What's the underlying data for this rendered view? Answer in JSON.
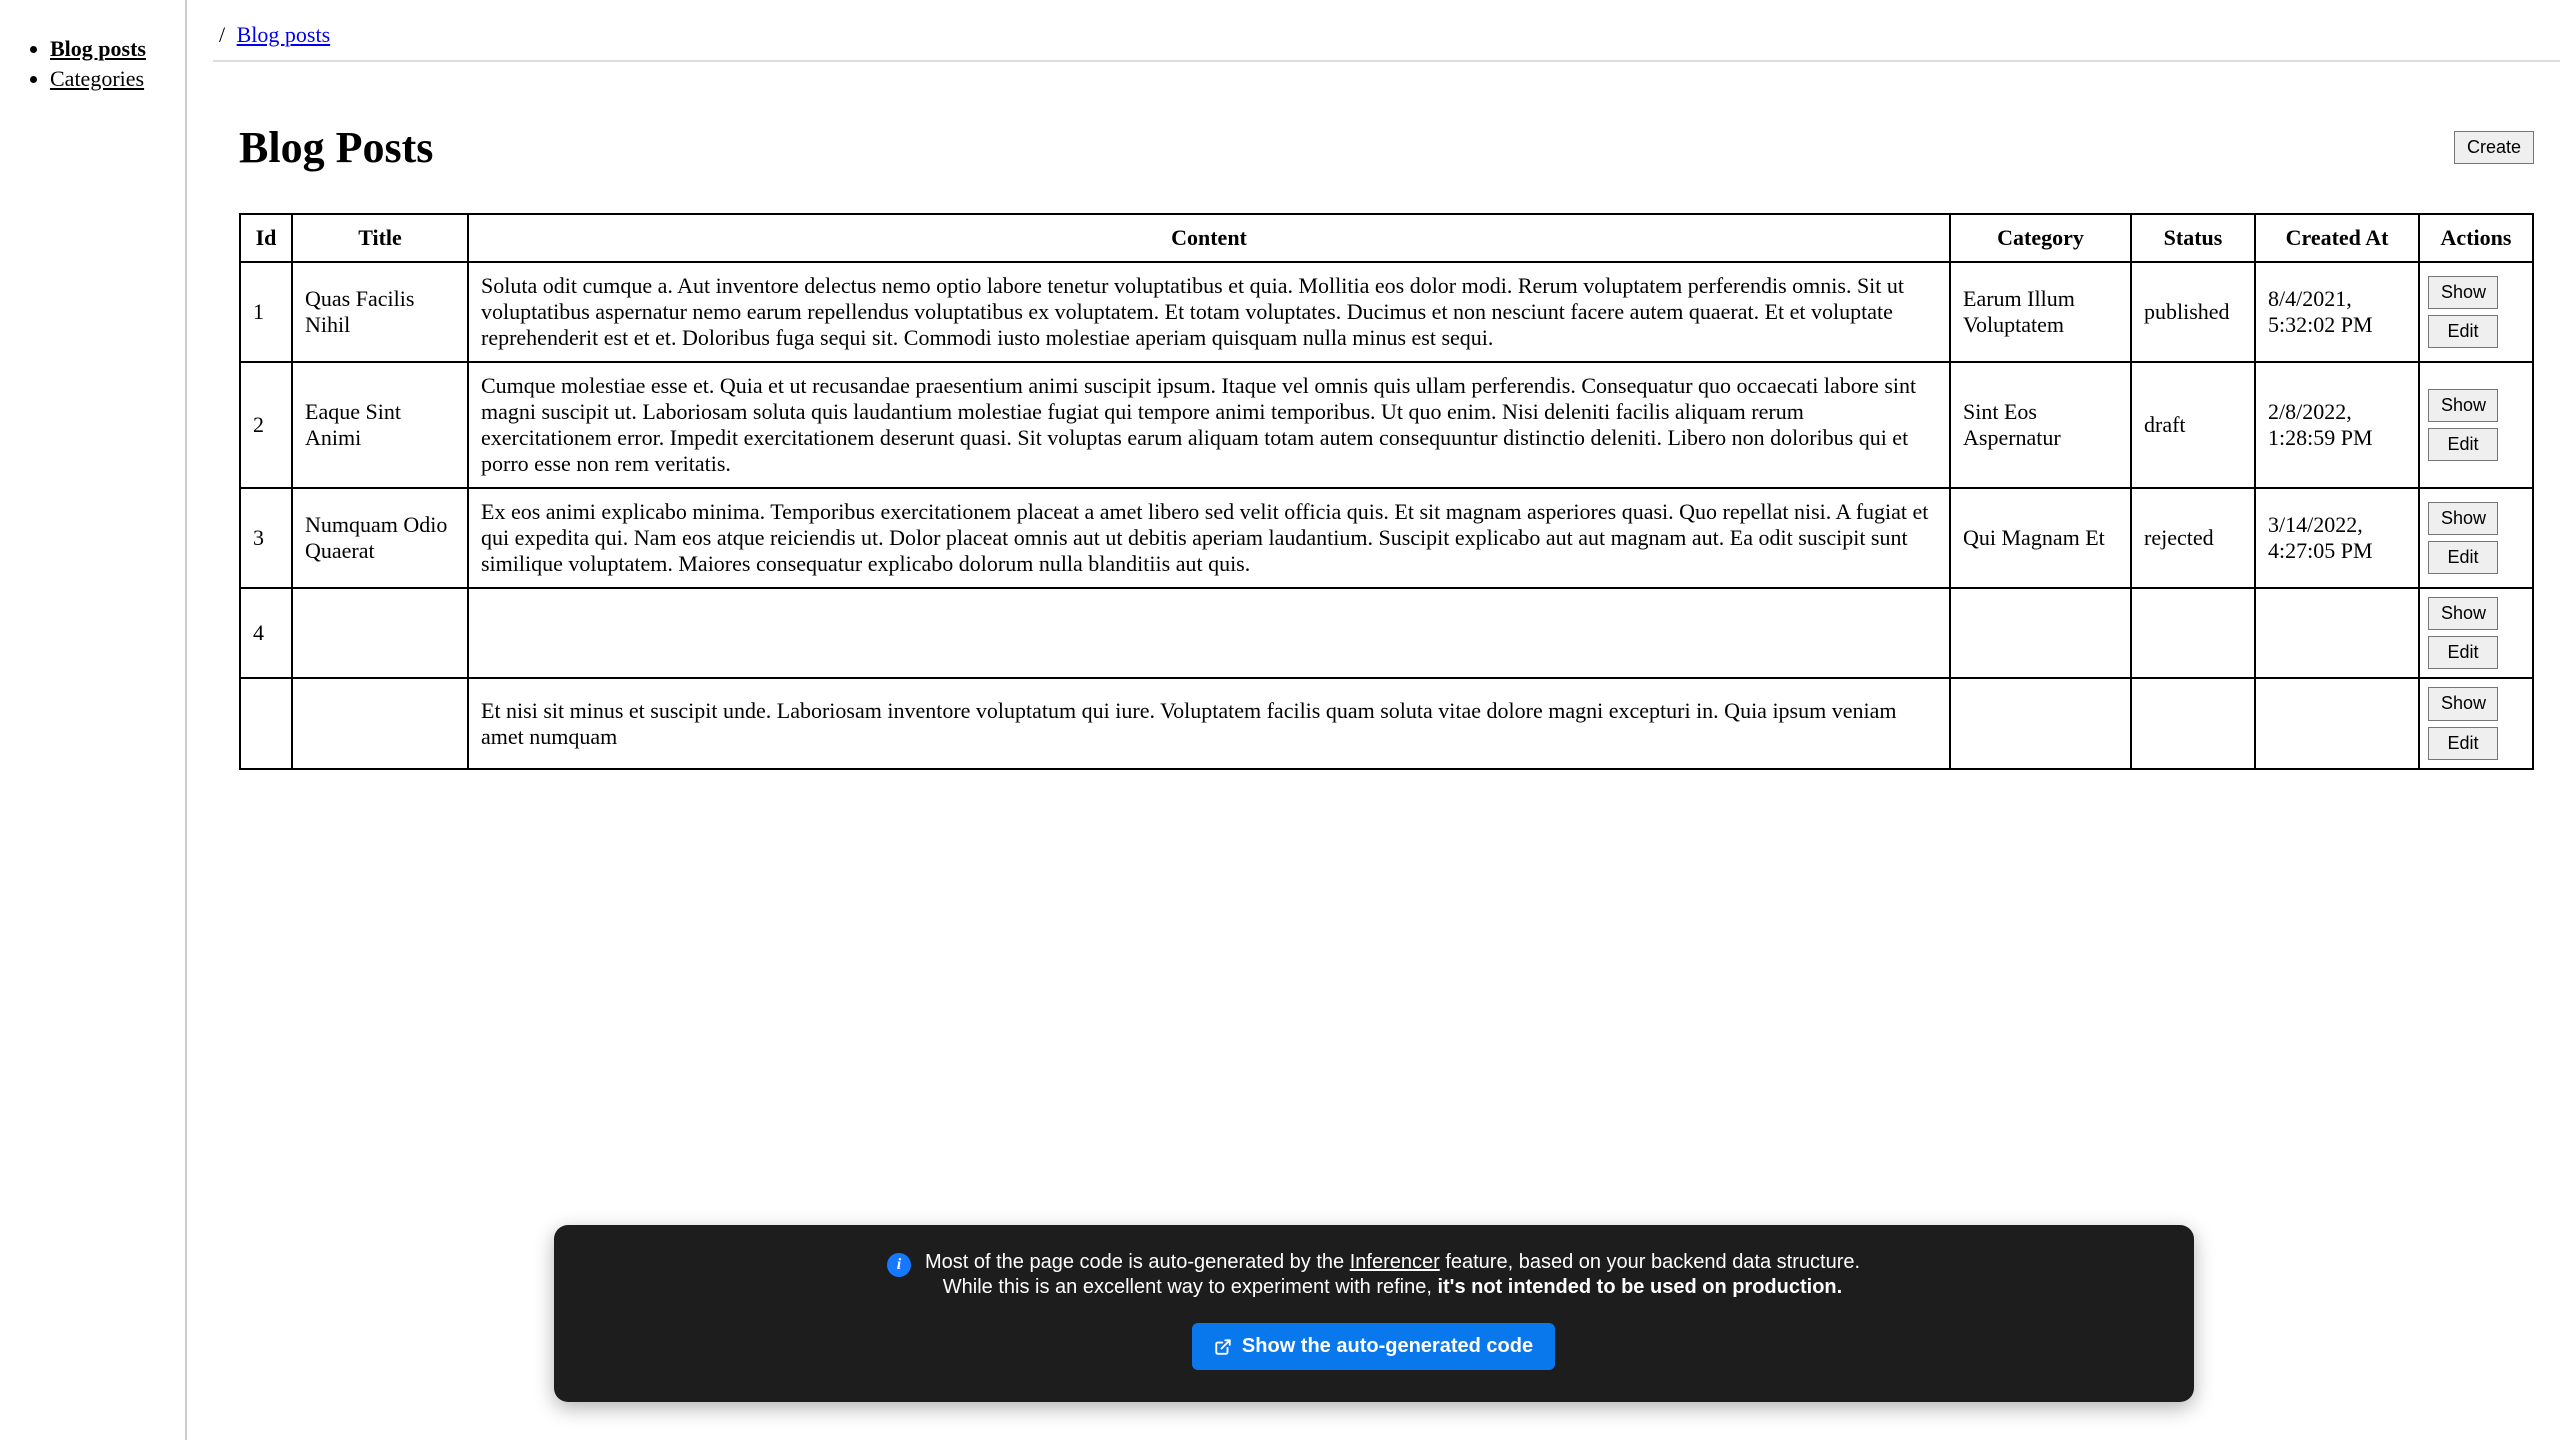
{
  "sidebar": {
    "items": [
      {
        "label": "Blog posts",
        "active": true
      },
      {
        "label": "Categories",
        "active": false
      }
    ]
  },
  "breadcrumb": {
    "sep": "/",
    "current": "Blog posts"
  },
  "page": {
    "title": "Blog Posts",
    "create_label": "Create"
  },
  "table": {
    "headers": {
      "id": "Id",
      "title": "Title",
      "content": "Content",
      "category": "Category",
      "status": "Status",
      "created_at": "Created At",
      "actions": "Actions"
    },
    "actions": {
      "show": "Show",
      "edit": "Edit"
    },
    "rows": [
      {
        "id": "1",
        "title": "Quas Facilis Nihil",
        "content": "Soluta odit cumque a. Aut inventore delectus nemo optio labore tenetur voluptatibus et quia. Mollitia eos dolor modi. Rerum voluptatem perferendis omnis. Sit ut voluptatibus aspernatur nemo earum repellendus voluptatibus ex voluptatem. Et totam voluptates. Ducimus et non nesciunt facere autem quaerat. Et et voluptate reprehenderit est et et. Doloribus fuga sequi sit. Commodi iusto molestiae aperiam quisquam nulla minus est sequi.",
        "category": "Earum Illum Voluptatem",
        "status": "published",
        "created_at": "8/4/2021, 5:32:02 PM"
      },
      {
        "id": "2",
        "title": "Eaque Sint Animi",
        "content": "Cumque molestiae esse et. Quia et ut recusandae praesentium animi suscipit ipsum. Itaque vel omnis quis ullam perferendis. Consequatur quo occaecati labore sint magni suscipit ut. Laboriosam soluta quis laudantium molestiae fugiat qui tempore animi temporibus. Ut quo enim. Nisi deleniti facilis aliquam rerum exercitationem error. Impedit exercitationem deserunt quasi. Sit voluptas earum aliquam totam autem consequuntur distinctio deleniti. Libero non doloribus qui et porro esse non rem veritatis.",
        "category": "Sint Eos Aspernatur",
        "status": "draft",
        "created_at": "2/8/2022, 1:28:59 PM"
      },
      {
        "id": "3",
        "title": "Numquam Odio Quaerat",
        "content": "Ex eos animi explicabo minima. Temporibus exercitationem placeat a amet libero sed velit officia quis. Et sit magnam asperiores quasi. Quo repellat nisi. A fugiat et qui expedita qui. Nam eos atque reiciendis ut. Dolor placeat omnis aut ut debitis aperiam laudantium. Suscipit explicabo aut aut magnam aut. Ea odit suscipit sunt similique voluptatem. Maiores consequatur explicabo dolorum nulla blanditiis aut quis.",
        "category": "Qui Magnam Et",
        "status": "rejected",
        "created_at": "3/14/2022, 4:27:05 PM"
      },
      {
        "id": "4",
        "title": "",
        "content": "",
        "category": "",
        "status": "",
        "created_at": ""
      },
      {
        "id": "",
        "title": "",
        "content": "Et nisi sit minus et suscipit unde. Laboriosam inventore voluptatum qui iure. Voluptatem facilis quam soluta vitae dolore magni excepturi in. Quia ipsum veniam amet numquam",
        "category": "",
        "status": "",
        "created_at": ""
      }
    ]
  },
  "toast": {
    "line1_pre": "Most of the page code is auto-generated by the ",
    "line1_link": "Inferencer",
    "line1_post": " feature, based on your backend data structure.",
    "line2_pre": "While this is an excellent way to experiment with refine, ",
    "line2_bold": "it's not intended to be used on production.",
    "button": "Show the auto-generated code"
  }
}
